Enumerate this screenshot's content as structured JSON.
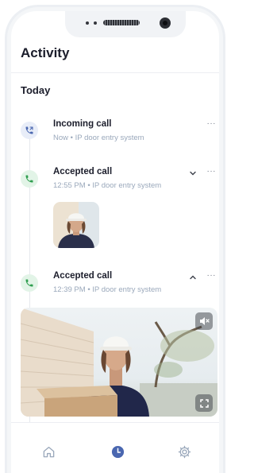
{
  "screen": {
    "title": "Activity",
    "section_label": "Today"
  },
  "activity": [
    {
      "title": "Incoming call",
      "time": "Now",
      "source": "IP door entry system",
      "status_color": "#4a67b0",
      "icon": "phone-incoming-icon"
    },
    {
      "title": "Accepted call",
      "time": "12:55 PM",
      "source": "IP door entry system",
      "status_color": "#2f9e4f",
      "icon": "phone-icon",
      "toggle": "chevron-down-icon"
    },
    {
      "title": "Accepted call",
      "time": "12:39 PM",
      "source": "IP door entry system",
      "status_color": "#2f9e4f",
      "icon": "phone-icon",
      "toggle": "chevron-up-icon"
    }
  ],
  "separator": "•",
  "more_label": "···",
  "video_controls": [
    "mute-icon",
    "fullscreen-icon"
  ],
  "nav": [
    {
      "name": "home-icon",
      "active": false
    },
    {
      "name": "history-icon",
      "active": true
    },
    {
      "name": "settings-icon",
      "active": false
    }
  ],
  "colors": {
    "accent": "#4a67b0",
    "success": "#2f9e4f",
    "muted": "#9aa8bb",
    "text": "#1b1d2b"
  }
}
